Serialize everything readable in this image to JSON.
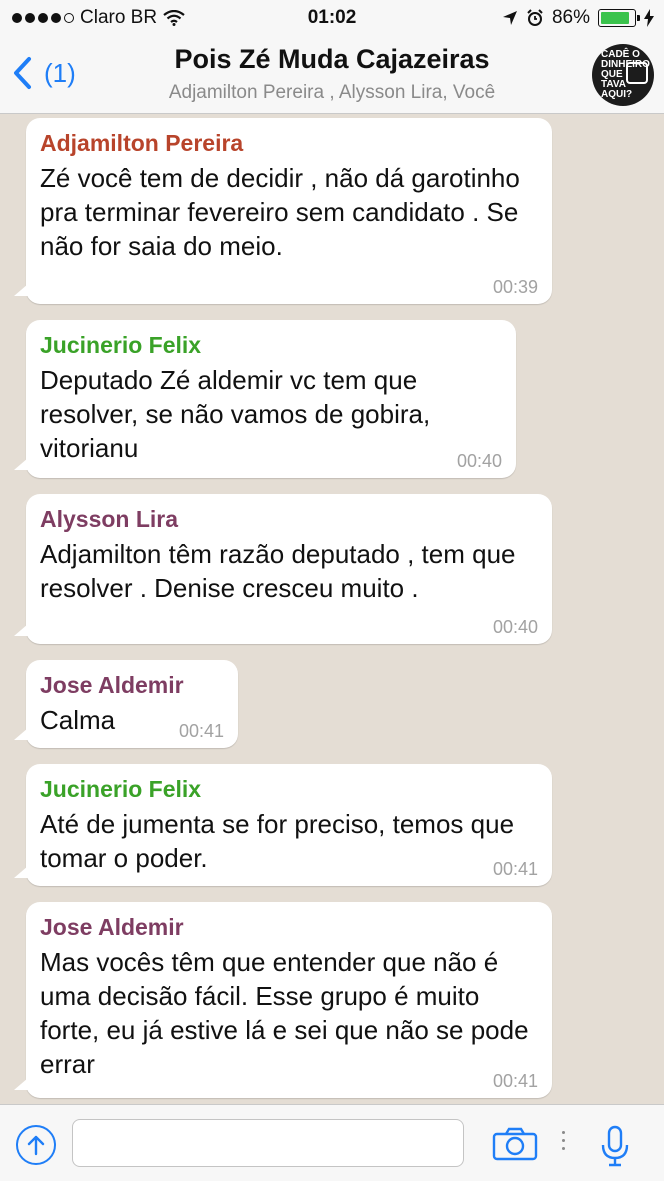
{
  "status_bar": {
    "carrier": "Claro BR",
    "time": "01:02",
    "battery": "86%",
    "battery_level": 0.86
  },
  "header": {
    "back_label": "(1)",
    "title": "Pois Zé Muda Cajazeiras",
    "subtitle": "Adjamilton Pereira , Alysson Lira, Você",
    "avatar_text": [
      "CADÊ O",
      "DINHEIRO",
      "QUE",
      "TAVA",
      "AQUI?"
    ]
  },
  "colors": {
    "link": "#1f7ef7",
    "adjamilton": "#b8442b",
    "jucinerio": "#3aa228",
    "alysson": "#7e3d62",
    "jose": "#7e3d62"
  },
  "messages": [
    {
      "sender": "Adjamilton Pereira",
      "text": "Zé você tem de decidir , não dá garotinho pra terminar fevereiro sem candidato . Se não for saia do meio.",
      "time": "00:39"
    },
    {
      "sender": "Jucinerio Felix",
      "text": "Deputado Zé aldemir vc tem que resolver, se não vamos de gobira, vitorianu",
      "time": "00:40"
    },
    {
      "sender": "Alysson Lira",
      "text": "Adjamilton têm razão deputado , tem que resolver . Denise cresceu muito .",
      "time": "00:40"
    },
    {
      "sender": "Jose Aldemir",
      "text": "Calma",
      "time": "00:41"
    },
    {
      "sender": "Jucinerio Felix",
      "text": "Até de jumenta se for preciso, temos que tomar o poder.",
      "time": "00:41"
    },
    {
      "sender": "Jose Aldemir",
      "text": "Mas vocês têm que entender que não é uma decisão fácil. Esse grupo é muito forte, eu já estive lá e sei que não se pode errar",
      "time": "00:41"
    }
  ],
  "input_bar": {
    "placeholder": "",
    "icons": [
      "upload-icon",
      "camera-icon",
      "microphone-icon"
    ]
  }
}
